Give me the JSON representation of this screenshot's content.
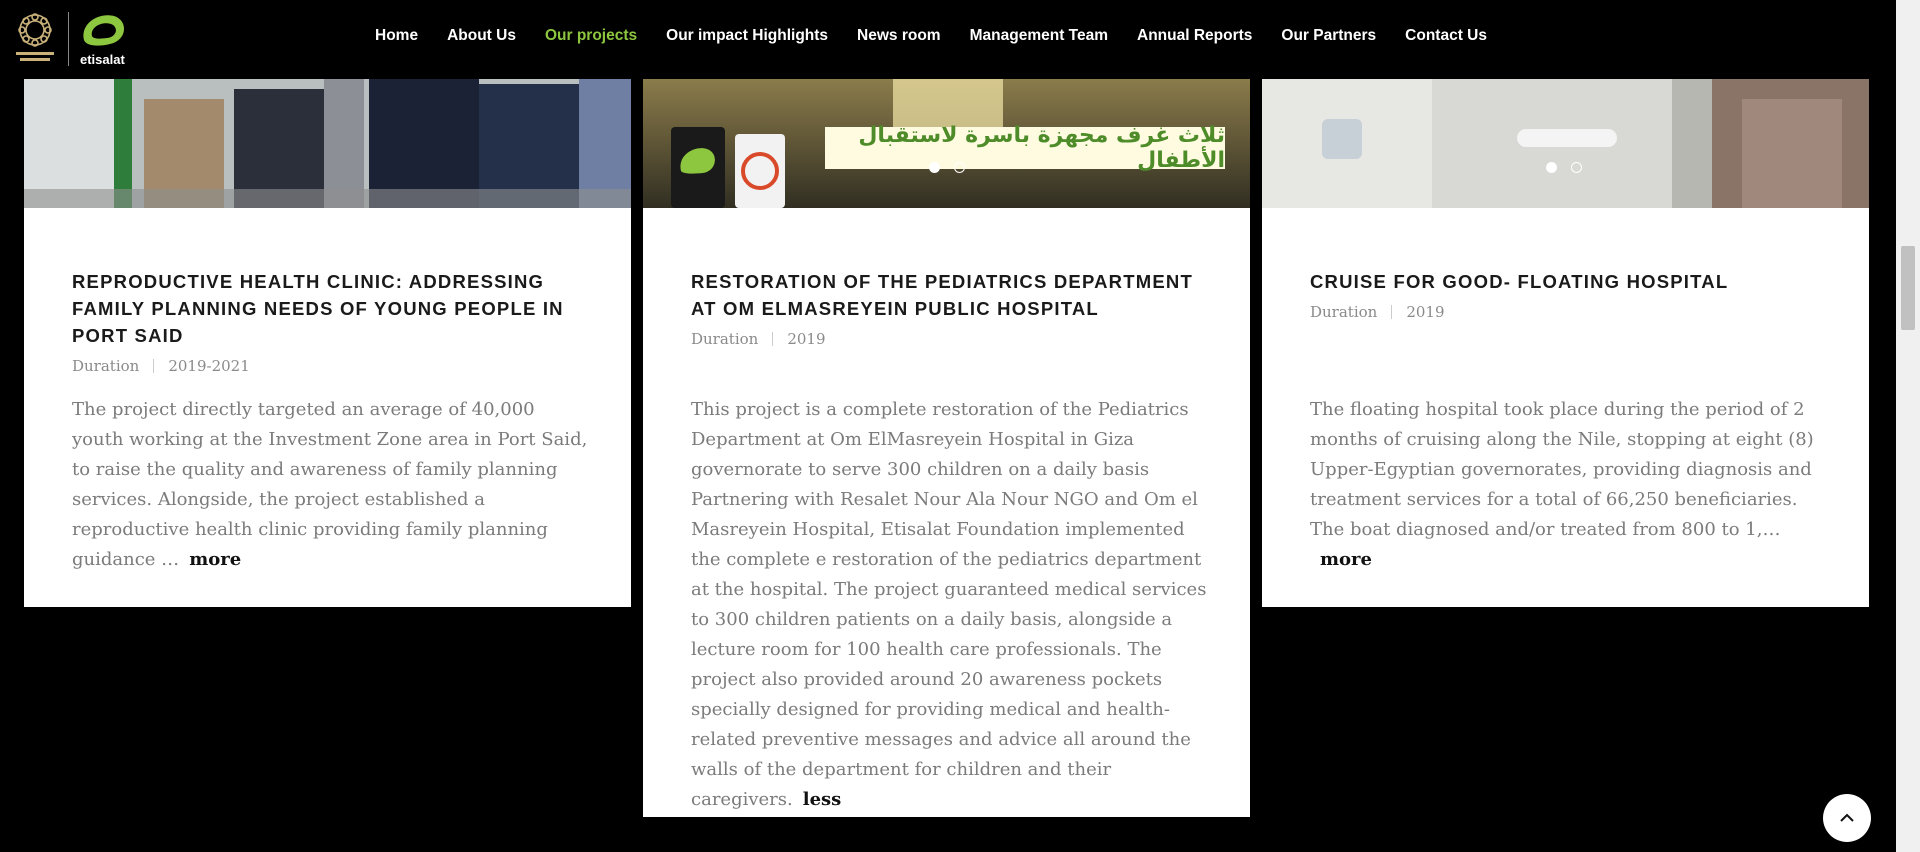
{
  "header": {
    "brand": "etisalat",
    "nav": [
      {
        "label": "Home",
        "active": false
      },
      {
        "label": "About Us",
        "active": false
      },
      {
        "label": "Our projects",
        "active": true
      },
      {
        "label": "Our impact Highlights",
        "active": false
      },
      {
        "label": "News room",
        "active": false
      },
      {
        "label": "Management Team",
        "active": false
      },
      {
        "label": "Annual Reports",
        "active": false
      },
      {
        "label": "Our Partners",
        "active": false
      },
      {
        "label": "Contact Us",
        "active": false
      }
    ]
  },
  "cards": [
    {
      "title": "REPRODUCTIVE HEALTH CLINIC: ADDRESSING FAMILY PLANNING NEEDS OF YOUNG PEOPLE IN PORT SAID",
      "duration_label": "Duration",
      "duration_value": "2019-2021",
      "description": "The project directly targeted an average of 40,000 youth working at the Investment Zone area in Port Said, to raise the quality and awareness of family planning services. Alongside, the project established a reproductive health clinic providing family planning guidance …",
      "toggle": "more"
    },
    {
      "title": "RESTORATION OF THE PEDIATRICS DEPARTMENT AT OM ELMASREYEIN PUBLIC HOSPITAL",
      "duration_label": "Duration",
      "duration_value": "2019",
      "banner_text": "ثلاث غرف مجهزة باسرة لاستقبال الأطفال",
      "description": "This project is a complete restoration of the Pediatrics Department at Om ElMasreyein Hospital in Giza governorate to serve 300 children on a daily basis Partnering with Resalet Nour Ala Nour NGO and Om el Masreyein Hospital, Etisalat Foundation implemented the complete e restoration of the pediatrics department at the hospital. The project guaranteed medical services to 300 children patients on a daily basis, alongside a lecture room for 100 health care professionals. The project also provided around 20 awareness pockets specially designed for providing medical and health-related preventive messages and advice all around the walls of the department for children and their caregivers.",
      "toggle": "less"
    },
    {
      "title": "CRUISE FOR GOOD- FLOATING HOSPITAL",
      "duration_label": "Duration",
      "duration_value": "2019",
      "description": "The floating hospital took place during the period of 2 months of cruising along the Nile, stopping at eight (8) Upper-Egyptian governorates, providing diagnosis and treatment services for a total of 66,250 beneficiaries. The boat diagnosed and/or treated from 800 to 1,…",
      "toggle": "more"
    }
  ],
  "colors": {
    "accent": "#8dc63f",
    "background": "#000000"
  },
  "icons": {
    "back_to_top": "chevron-up-icon"
  }
}
